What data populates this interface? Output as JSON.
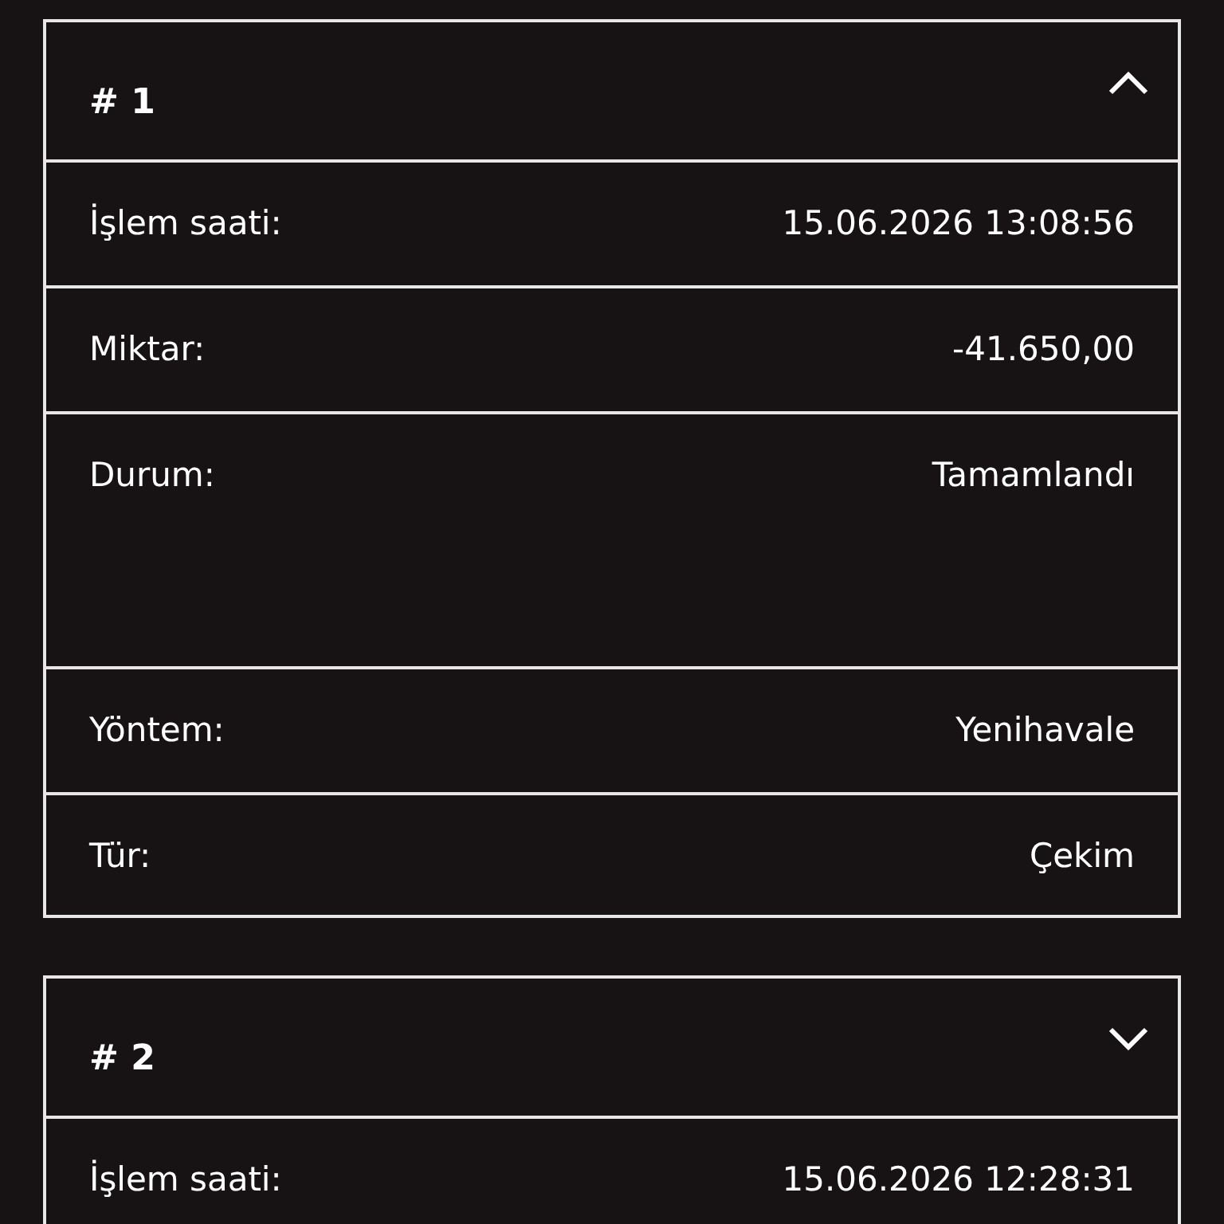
{
  "transactions": [
    {
      "title": "# 1",
      "expanded": true,
      "rows": [
        {
          "kind": "line",
          "label": "İşlem saati:",
          "value": "15.06.2026 13:08:56"
        },
        {
          "kind": "line",
          "label": "Miktar:",
          "value": "-41.650,00"
        },
        {
          "kind": "status",
          "label": "Durum:",
          "value": "Tamamlandı"
        },
        {
          "kind": "line",
          "label": "Yöntem:",
          "value": "Yenihavale"
        },
        {
          "kind": "line",
          "label": "Tür:",
          "value": "Çekim"
        }
      ]
    },
    {
      "title": "# 2",
      "expanded": false,
      "rows": [
        {
          "kind": "line",
          "label": "İşlem saati:",
          "value": "15.06.2026 12:28:31"
        }
      ]
    }
  ]
}
